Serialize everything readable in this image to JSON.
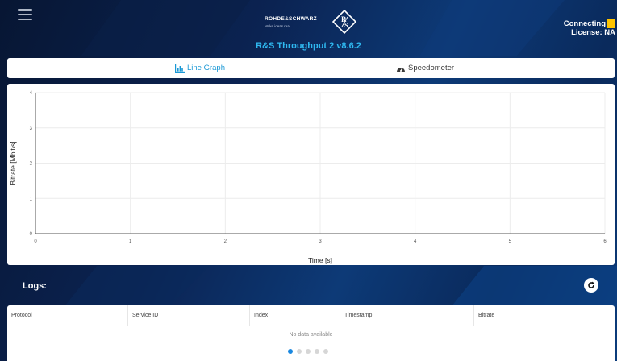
{
  "header": {
    "brand_name": "ROHDE&SCHWARZ",
    "brand_tagline": "Make ideas real",
    "app_title": "R&S Throughput 2 v8.6.2",
    "status": "Connecting",
    "license": "License: NA",
    "status_color": "#ffc400"
  },
  "tabs": {
    "line_graph": "Line Graph",
    "speedometer": "Speedometer",
    "active": "Line Graph",
    "active_color": "#1a98d5"
  },
  "chart_data": {
    "type": "line",
    "xlabel": "Time [s]",
    "ylabel": "Bitrate [Mbit/s]",
    "xlim": [
      0,
      6
    ],
    "ylim": [
      0,
      4
    ],
    "x_ticks": [
      "0",
      "1",
      "2",
      "3",
      "4",
      "5",
      "6"
    ],
    "y_ticks": [
      "0",
      "1",
      "2",
      "3",
      "4"
    ],
    "grid": true,
    "series": []
  },
  "logs": {
    "title": "Logs:",
    "columns": [
      "Protocol",
      "Service ID",
      "Index",
      "Timestamp",
      "Bitrate"
    ],
    "rows": [],
    "empty_text": "No data available",
    "pages": 5,
    "current_page": 1
  }
}
